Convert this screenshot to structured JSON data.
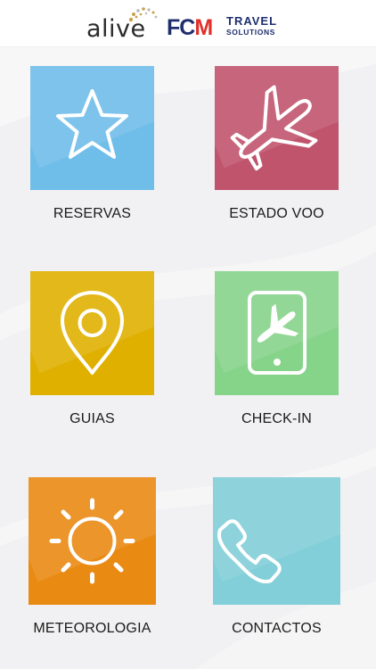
{
  "header": {
    "alive_logo_text": "alive",
    "fcm_logo_text": "FCM",
    "fcm_travel_text": "TRAVEL",
    "fcm_solutions_text": "SOLUTIONS",
    "colors": {
      "fcm_blue": "#1f2f6e",
      "fcm_red": "#e0302a",
      "alive_gold": "#c9a24a"
    }
  },
  "menu": {
    "reservas": {
      "label": "RESERVAS",
      "icon": "star-icon",
      "color": "#6fbde9"
    },
    "estado_voo": {
      "label": "ESTADO VOO",
      "icon": "airplane-icon",
      "color": "#c0546c"
    },
    "guias": {
      "label": "GUIAS",
      "icon": "location-pin-icon",
      "color": "#dfb000"
    },
    "check_in": {
      "label": "CHECK-IN",
      "icon": "phone-airplane-icon",
      "color": "#86d38a"
    },
    "meteorologia": {
      "label": "METEOROLOGIA",
      "icon": "sun-icon",
      "color": "#e98a12"
    },
    "contactos": {
      "label": "CONTACTOS",
      "icon": "phone-handset-icon",
      "color": "#82cfd9"
    }
  }
}
